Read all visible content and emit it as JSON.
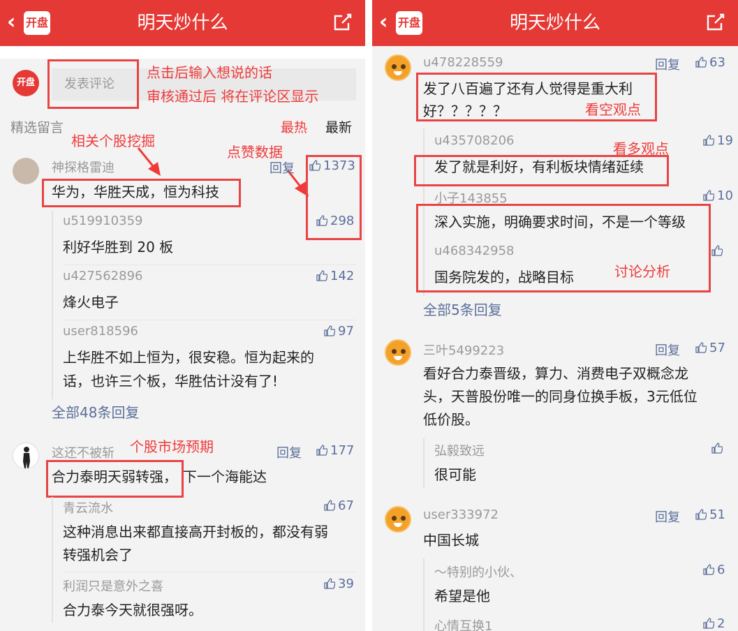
{
  "header": {
    "back_icon": "‹",
    "logo": "开盘",
    "title": "明天炒什么",
    "share_icon": "share-icon"
  },
  "left": {
    "logo_badge": "开盘",
    "comment_placeholder": "发表评论",
    "ann_input_1": "点击后输入想说的话",
    "ann_input_2": "审核通过后 将在评论区显示",
    "section_label": "精选留言",
    "sort_hot": "最热",
    "sort_new": "最新",
    "ann_stock": "相关个股挖掘",
    "ann_likes": "点赞数据",
    "c1": {
      "user": "神探格雷迪",
      "reply": "回复",
      "likes": "1373",
      "text": "华为，华胜天成，恒为科技"
    },
    "r1": {
      "user": "u519910359",
      "likes": "298",
      "text": "利好华胜到 20 板"
    },
    "r2": {
      "user": "u427562896",
      "likes": "142",
      "text": "烽火电子"
    },
    "r3": {
      "user": "user818596",
      "likes": "97",
      "text1": "上华胜不如上恒为，很安稳。恒为起来的",
      "text2": "话，也许三个板，华胜估计没有了!"
    },
    "all1": "全部48条回复",
    "ann_expect": "个股市场预期",
    "c2": {
      "user": "这还不被斩",
      "reply": "回复",
      "likes": "177",
      "text1": "合力泰明天弱转强，",
      "text2": "下一个海能达"
    },
    "r4": {
      "user": "青云流水",
      "likes": "67",
      "text1": "这种消息出来都直接高开封板的，都没有弱",
      "text2": "转强机会了"
    },
    "r5": {
      "user": "利润只是意外之喜",
      "likes": "39",
      "text": "合力泰今天就很强呀。"
    }
  },
  "right": {
    "c1": {
      "user": "u478228559",
      "reply": "回复",
      "likes": "63",
      "text1": "发了八百遍了还有人觉得是重大利",
      "text2": "好？？？？？"
    },
    "ann_bear": "看空观点",
    "r1": {
      "user": "u435708206",
      "likes": "19",
      "text": "发了就是利好，有利板块情绪延续"
    },
    "ann_bull": "看多观点",
    "r2": {
      "user": "小子143855",
      "likes": "10",
      "text": "深入实施，明确要求时间，不是一个等级"
    },
    "r3": {
      "user": "u468342958",
      "text": "国务院发的，战略目标"
    },
    "ann_discuss": "讨论分析",
    "all1": "全部5条回复",
    "c2": {
      "user": "三叶5499223",
      "reply": "回复",
      "likes": "57",
      "text1": "看好合力泰晋级，算力、消费电子双概念龙",
      "text2": "头，天普股份唯一的同身位换手板，3元低位",
      "text3": "低价股。"
    },
    "r4": {
      "user": "弘毅致远",
      "text": "很可能"
    },
    "c3": {
      "user": "user333972",
      "reply": "回复",
      "likes": "51",
      "text": "中国长城"
    },
    "r5": {
      "user": "～特别的小伙、",
      "likes": "6",
      "text": "希望是他"
    },
    "r6": {
      "user": "心情互换1",
      "likes": "2"
    }
  },
  "colors": {
    "brand": "#e53935",
    "annotation": "#f03a3a",
    "link": "#5b6f9a"
  }
}
